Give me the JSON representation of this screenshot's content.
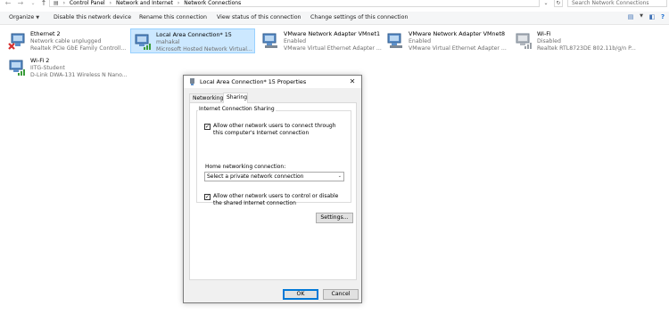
{
  "address_bar": {
    "path": [
      "Control Panel",
      "Network and Internet",
      "Network Connections"
    ],
    "search_placeholder": "Search Network Connections"
  },
  "command_bar": {
    "organize": "Organize",
    "disable": "Disable this network device",
    "rename": "Rename this connection",
    "view_status": "View status of this connection",
    "change_settings": "Change settings of this connection"
  },
  "adapters": [
    {
      "name": "Ethernet 2",
      "status": "Network cable unplugged",
      "device": "Realtek PCIe GbE Family Controll...",
      "icon": "ethernet-disconnected-icon"
    },
    {
      "name": "Local Area Connection* 15",
      "status": "mahakal",
      "device": "Microsoft Hosted Network Virtual...",
      "icon": "ethernet-connected-icon"
    },
    {
      "name": "VMware Network Adapter VMnet1",
      "status": "Enabled",
      "device": "VMware Virtual Ethernet Adapter ...",
      "icon": "ethernet-icon"
    },
    {
      "name": "VMware Network Adapter VMnet8",
      "status": "Enabled",
      "device": "VMware Virtual Ethernet Adapter ...",
      "icon": "ethernet-icon"
    },
    {
      "name": "Wi-Fi",
      "status": "Disabled",
      "device": "Realtek RTL8723DE 802.11b/g/n P...",
      "icon": "wifi-disabled-icon"
    },
    {
      "name": "Wi-Fi 2",
      "status": "IITG-Student",
      "device": "D-Link DWA-131 Wireless N Nano...",
      "icon": "wifi-connected-icon"
    }
  ],
  "dialog": {
    "title": "Local Area Connection* 15 Properties",
    "tabs": [
      "Networking",
      "Sharing"
    ],
    "active_tab": "Sharing",
    "group_label": "Internet Connection Sharing",
    "allow_connect": "Allow other network users to connect through this computer's Internet connection",
    "allow_connect_checked": true,
    "home_label": "Home networking connection:",
    "home_select_value": "Select a private network connection",
    "allow_control": "Allow other network users to control or disable the shared Internet connection",
    "allow_control_checked": true,
    "settings_button": "Settings...",
    "ok_button": "OK",
    "cancel_button": "Cancel"
  },
  "colors": {
    "selection_bg": "#cce8ff",
    "selection_border": "#99d1ff",
    "default_button_border": "#0078d7"
  }
}
